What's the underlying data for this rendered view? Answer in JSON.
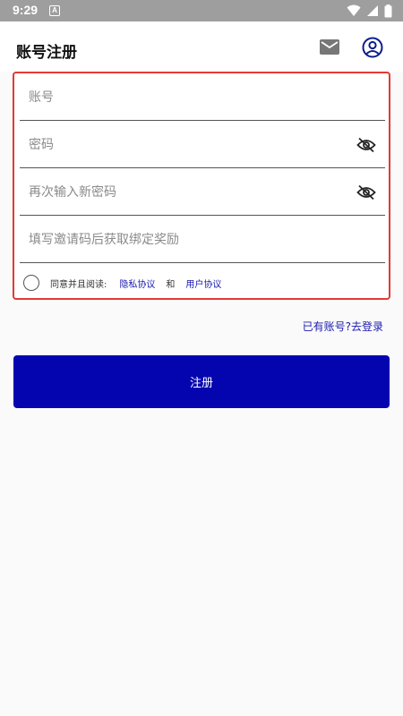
{
  "status_bar": {
    "time": "9:29",
    "notification_letter": "A",
    "icons": [
      "wifi-icon",
      "signal-icon",
      "battery-icon"
    ]
  },
  "header": {
    "title": "账号注册",
    "icons": [
      "mail-icon",
      "account-circle-icon"
    ]
  },
  "form": {
    "account_placeholder": "账号",
    "password_placeholder": "密码",
    "confirm_password_placeholder": "再次输入新密码",
    "invite_code_placeholder": "填写邀请码后获取绑定奖励",
    "agree": {
      "prefix": "同意并且阅读:",
      "privacy_link": "隐私协议",
      "and_text": "和",
      "user_agreement_link": "用户协议",
      "checked": false
    }
  },
  "login_link": "已有账号?去登录",
  "register_button": "注册",
  "colors": {
    "primary": "#0505b0",
    "link": "#1a1ab0",
    "highlight_border": "#e53935",
    "status_bar": "#9e9e9e"
  }
}
